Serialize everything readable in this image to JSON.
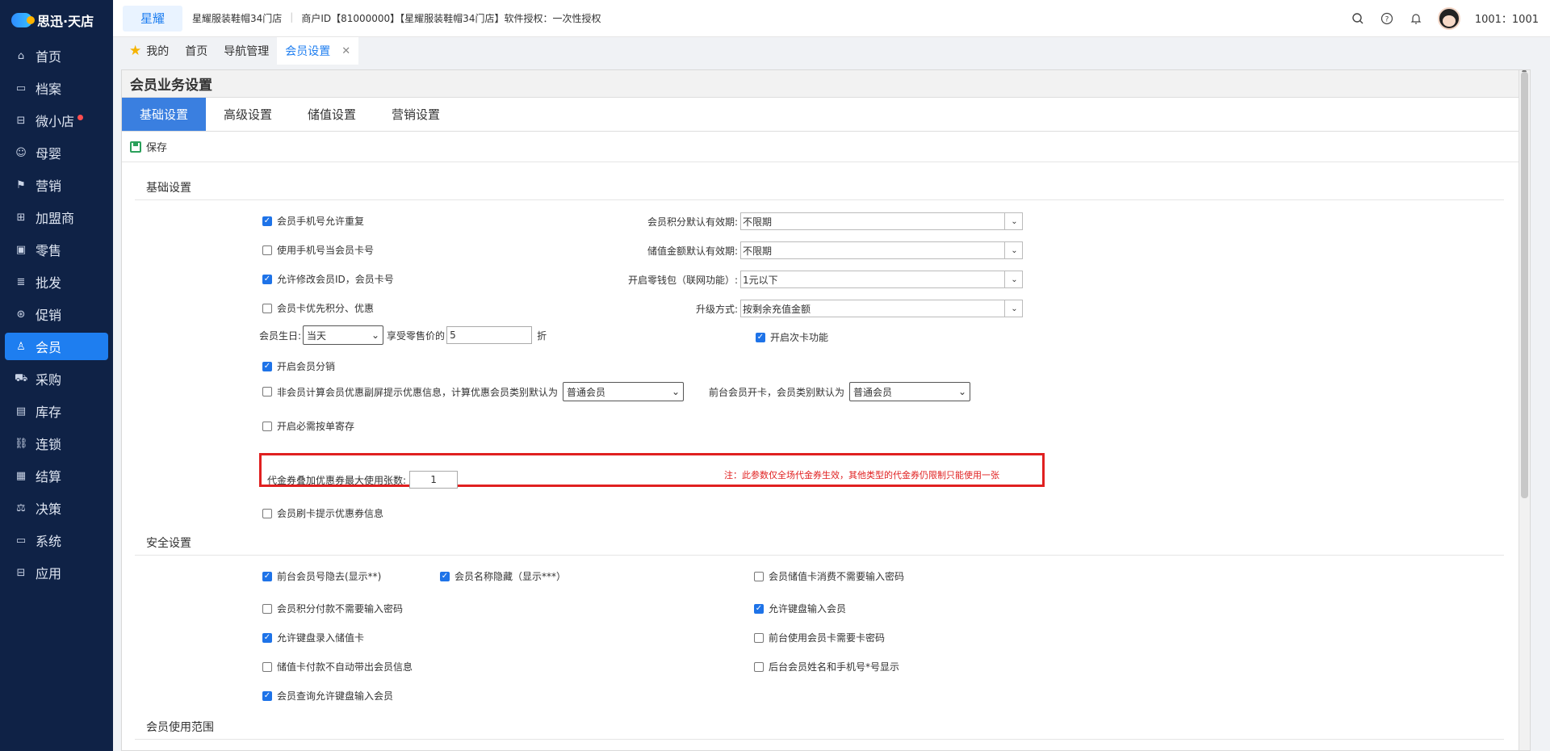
{
  "app": {
    "logo_text": "思迅·天店",
    "brand": "星耀"
  },
  "store": {
    "name": "星耀服装鞋帽34门店",
    "merchant": "商户ID【81000000】【星耀服装鞋帽34门店】软件授权：一次性授权"
  },
  "user": {
    "name": "1001：1001"
  },
  "nav": [
    {
      "label": "首页",
      "icon": "home-icon"
    },
    {
      "label": "档案",
      "icon": "folder-icon"
    },
    {
      "label": "微小店",
      "icon": "shop-icon"
    },
    {
      "label": "母婴",
      "icon": "baby-icon"
    },
    {
      "label": "营销",
      "icon": "marketing-icon"
    },
    {
      "label": "加盟商",
      "icon": "franchise-icon"
    },
    {
      "label": "零售",
      "icon": "retail-icon"
    },
    {
      "label": "批发",
      "icon": "wholesale-icon"
    },
    {
      "label": "促销",
      "icon": "promo-icon"
    },
    {
      "label": "会员",
      "icon": "member-icon"
    },
    {
      "label": "采购",
      "icon": "cart-icon"
    },
    {
      "label": "库存",
      "icon": "inventory-icon"
    },
    {
      "label": "连锁",
      "icon": "chain-icon"
    },
    {
      "label": "结算",
      "icon": "settle-icon"
    },
    {
      "label": "决策",
      "icon": "decision-icon"
    },
    {
      "label": "系统",
      "icon": "system-icon"
    },
    {
      "label": "应用",
      "icon": "app-icon"
    }
  ],
  "tabs": {
    "mine": "我的",
    "home": "首页",
    "navmgr": "导航管理",
    "current": "会员设置"
  },
  "panel": {
    "title": "会员业务设置",
    "subtabs": [
      "基础设置",
      "高级设置",
      "储值设置",
      "营销设置"
    ],
    "save": "保存"
  },
  "basic": {
    "title": "基础设置",
    "phone_dup": "会员手机号允许重复",
    "use_phone_card": "使用手机号当会员卡号",
    "allow_edit_id": "允许修改会员ID，会员卡号",
    "card_priority": "会员卡优先积分、优惠",
    "birthday_label": "会员生日:",
    "birthday_value": "当天",
    "discount_label": "享受零售价的",
    "discount_value": "5",
    "discount_unit": "折",
    "distribution": "开启会员分销",
    "non_member_hint": "非会员计算会员优惠副屏提示优惠信息，计算优惠会员类别默认为",
    "non_member_type": "普通会员",
    "front_open_label": "前台会员开卡，会员类别默认为",
    "front_open_type": "普通会员",
    "must_deposit": "开启必需按单寄存",
    "coupon_label": "代金券叠加优惠券最大使用张数:",
    "coupon_value": "1",
    "coupon_note": "注：此参数仅全场代金券生效，其他类型的代金券仍限制只能使用一张",
    "swipe_hint": "会员刷卡提示优惠券信息",
    "points_validity_label": "会员积分默认有效期:",
    "points_validity": "不限期",
    "stored_validity_label": "储值金额默认有效期:",
    "stored_validity": "不限期",
    "wallet_label": "开启零钱包（联网功能）:",
    "wallet_value": "1元以下",
    "upgrade_label": "升级方式:",
    "upgrade_value": "按剩余充值金额",
    "times_card": "开启次卡功能"
  },
  "security": {
    "title": "安全设置",
    "hide_card_no": "前台会员号隐去(显示**)",
    "hide_name": "会员名称隐藏（显示***）",
    "no_pwd_stored": "会员储值卡消费不需要输入密码",
    "no_pwd_points": "会员积分付款不需要输入密码",
    "keyboard_member": "允许键盘输入会员",
    "keyboard_stored": "允许键盘录入储值卡",
    "front_card_pwd": "前台使用会员卡需要卡密码",
    "no_auto_member": "储值卡付款不自动带出会员信息",
    "backend_mask": "后台会员姓名和手机号*号显示",
    "query_keyboard": "会员查询允许键盘输入会员"
  },
  "scope": {
    "title": "会员使用范围"
  }
}
